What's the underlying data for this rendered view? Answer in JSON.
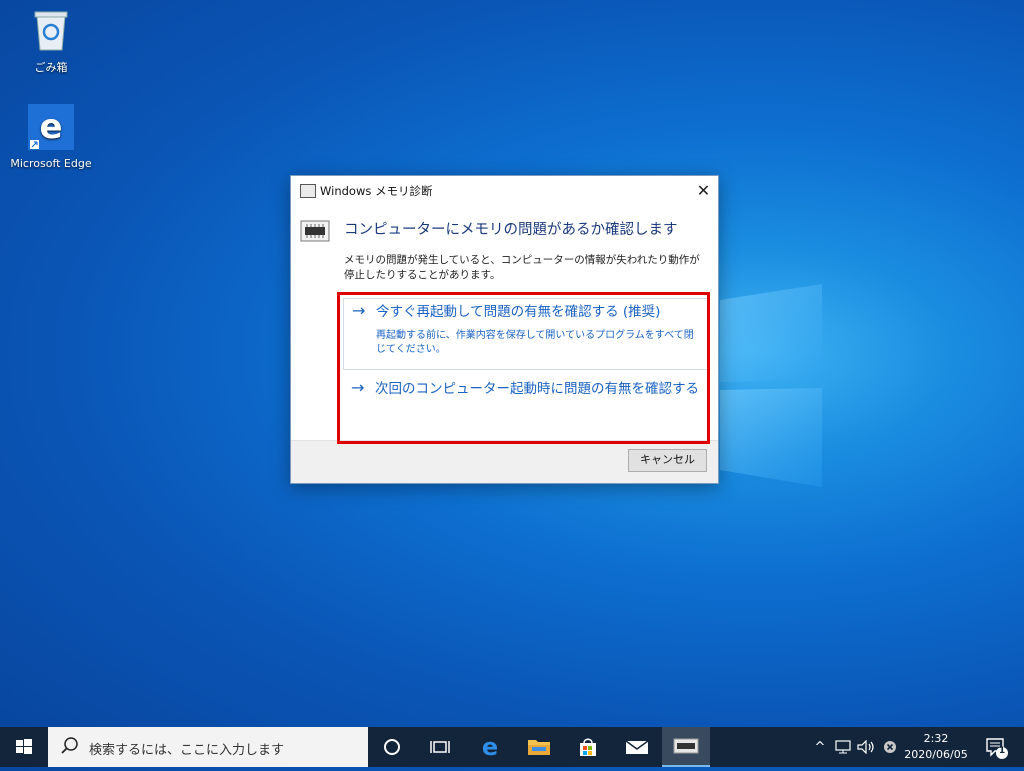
{
  "desktop": {
    "icons": [
      {
        "label": "ごみ箱"
      },
      {
        "label": "Microsoft Edge"
      }
    ]
  },
  "dialog": {
    "title": "Windows メモリ診断",
    "close_symbol": "✕",
    "heading": "コンピューターにメモリの問題があるか確認します",
    "description": "メモリの問題が発生していると、コンピューターの情報が失われたり動作が停止したりすることがあります。",
    "options": [
      {
        "label": "今すぐ再起動して問題の有無を確認する (推奨)",
        "sub": "再起動する前に、作業内容を保存して開いているプログラムをすべて閉じてください。",
        "arrow": "→"
      },
      {
        "label": "次回のコンピューター起動時に問題の有無を確認する",
        "arrow": "→"
      }
    ],
    "cancel_label": "キャンセル"
  },
  "taskbar": {
    "search_placeholder": "検索するには、ここに入力します",
    "clock_time": "2:32",
    "clock_date": "2020/06/05",
    "notification_count": "1",
    "tray_chevron": "^"
  },
  "colors": {
    "link_blue": "#1b63c2",
    "heading_blue": "#1b3a7d",
    "highlight_red": "#e00000",
    "taskbar": "#12253a"
  }
}
